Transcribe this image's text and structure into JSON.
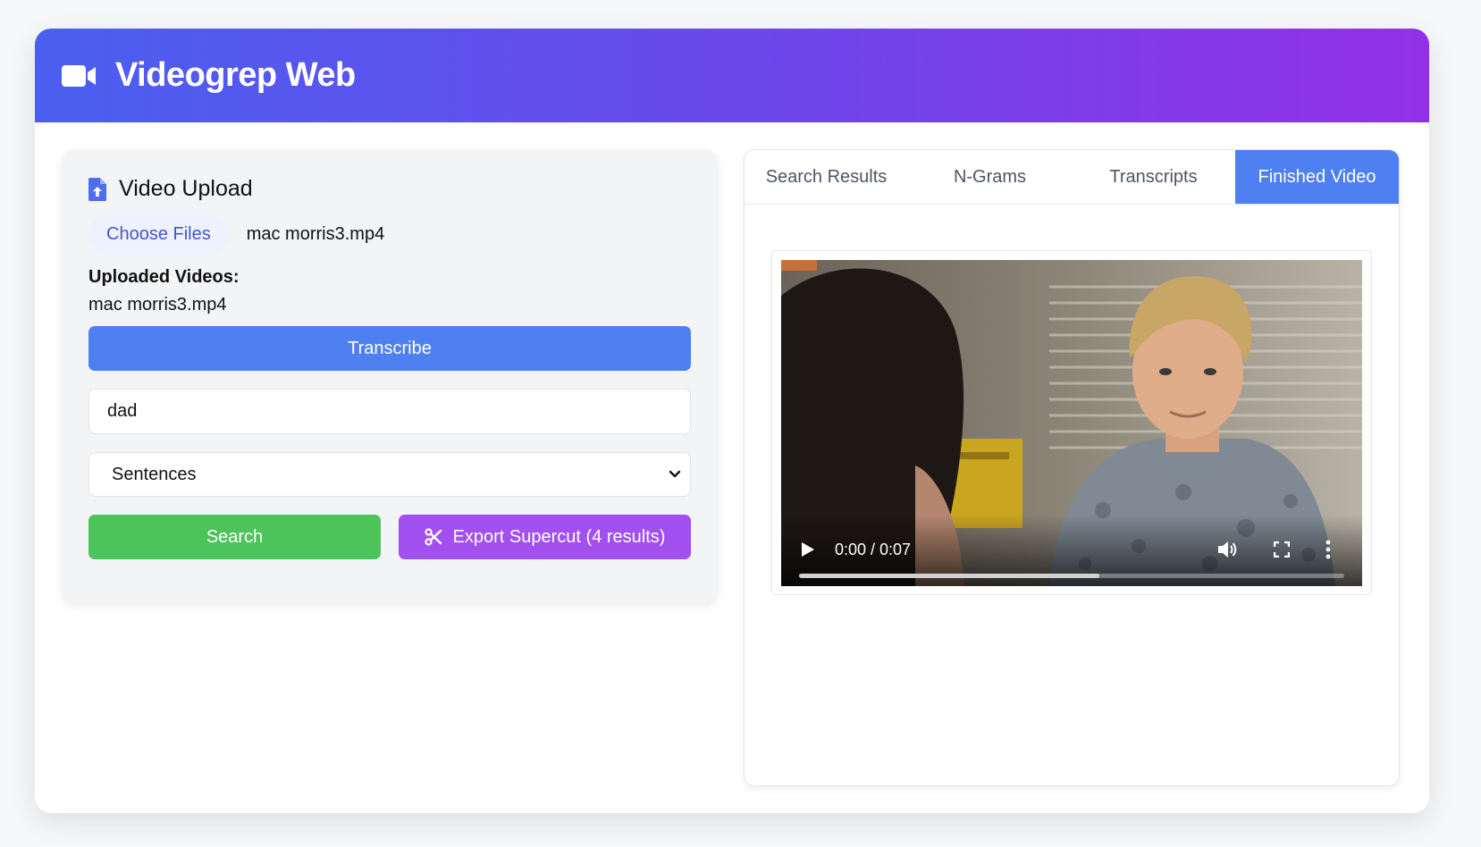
{
  "header": {
    "title": "Videogrep Web",
    "icon": "video-camera-icon"
  },
  "upload_panel": {
    "title": "Video Upload",
    "icon": "file-upload-icon",
    "choose_files_label": "Choose Files",
    "selected_file": "mac morris3.mp4",
    "uploaded_label": "Uploaded Videos:",
    "uploaded_videos": [
      "mac morris3.mp4"
    ],
    "transcribe_label": "Transcribe",
    "search_query": "dad",
    "search_type_selected": "Sentences",
    "search_label": "Search",
    "export_label": "Export Supercut (4 results)"
  },
  "results_panel": {
    "tabs": [
      {
        "label": "Search Results",
        "active": false
      },
      {
        "label": "N-Grams",
        "active": false
      },
      {
        "label": "Transcripts",
        "active": false
      },
      {
        "label": "Finished Video",
        "active": true
      }
    ],
    "video": {
      "time_display": "0:00 / 0:07",
      "progress_fraction": 0.55
    }
  },
  "colors": {
    "header_gradient_start": "#4a5ff0",
    "header_gradient_end": "#9230e8",
    "primary_blue": "#4f80f2",
    "search_green": "#4cc45a",
    "export_purple": "#a24ff0"
  }
}
